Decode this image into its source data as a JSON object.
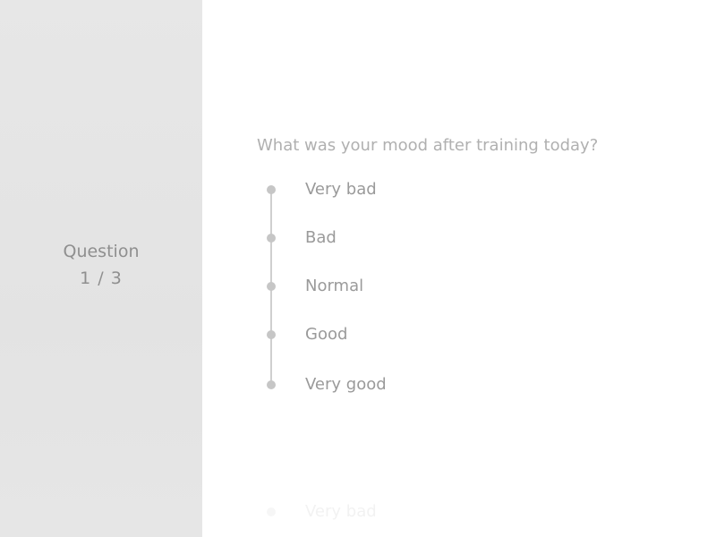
{
  "progress": {
    "label": "Question",
    "count": "1 / 3"
  },
  "question": {
    "text": "What was your mood after training today?",
    "options": [
      {
        "label": "Very bad"
      },
      {
        "label": "Bad"
      },
      {
        "label": "Normal"
      },
      {
        "label": "Good"
      },
      {
        "label": "Very good"
      }
    ]
  },
  "next_preview": {
    "first_option": "Very bad"
  },
  "colors": {
    "sidebar": "#e5e5e5",
    "text": "#9a9a9a",
    "dot": "#c6c6c6"
  }
}
